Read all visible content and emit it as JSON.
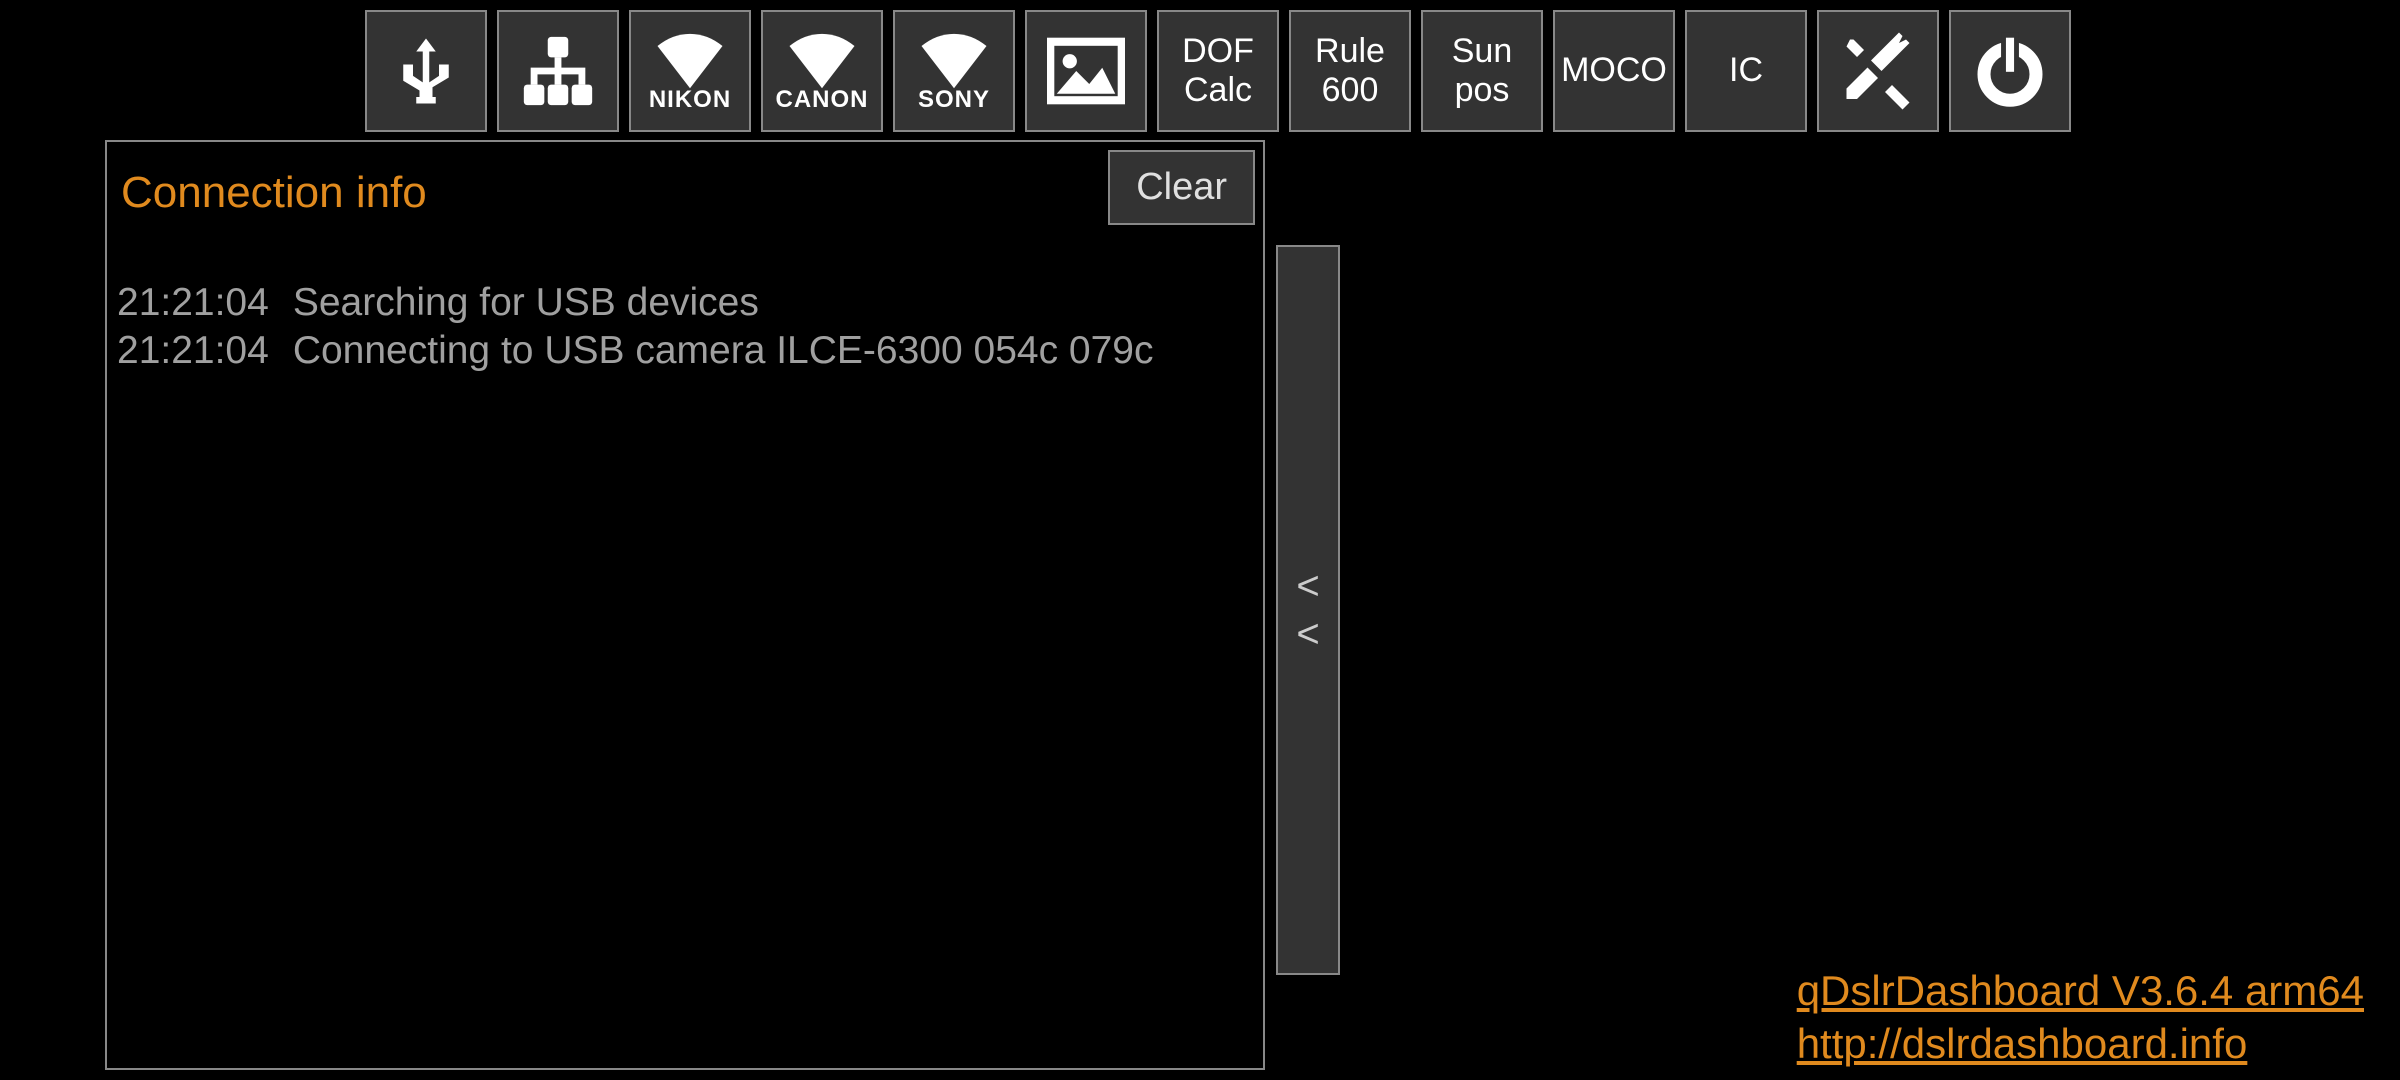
{
  "toolbar": {
    "usb": "usb",
    "network": "network",
    "wifi_nikon_label": "NIKON",
    "wifi_canon_label": "CANON",
    "wifi_sony_label": "SONY",
    "gallery": "gallery",
    "dof_line1": "DOF",
    "dof_line2": "Calc",
    "rule_line1": "Rule",
    "rule_line2": "600",
    "sun_line1": "Sun",
    "sun_line2": "pos",
    "moco": "MOCO",
    "ic": "IC",
    "tools": "tools",
    "power": "power"
  },
  "panel": {
    "title": "Connection info",
    "clear_label": "Clear",
    "log": [
      {
        "time": "21:21:04",
        "msg": "Searching for USB devices"
      },
      {
        "time": "21:21:04",
        "msg": "Connecting to USB camera ILCE-6300 054c 079c"
      }
    ]
  },
  "collapse": {
    "arrow1": "<",
    "arrow2": "<"
  },
  "footer": {
    "app_version": "qDslrDashboard V3.6.4 arm64",
    "url": "http://dslrdashboard.info"
  }
}
